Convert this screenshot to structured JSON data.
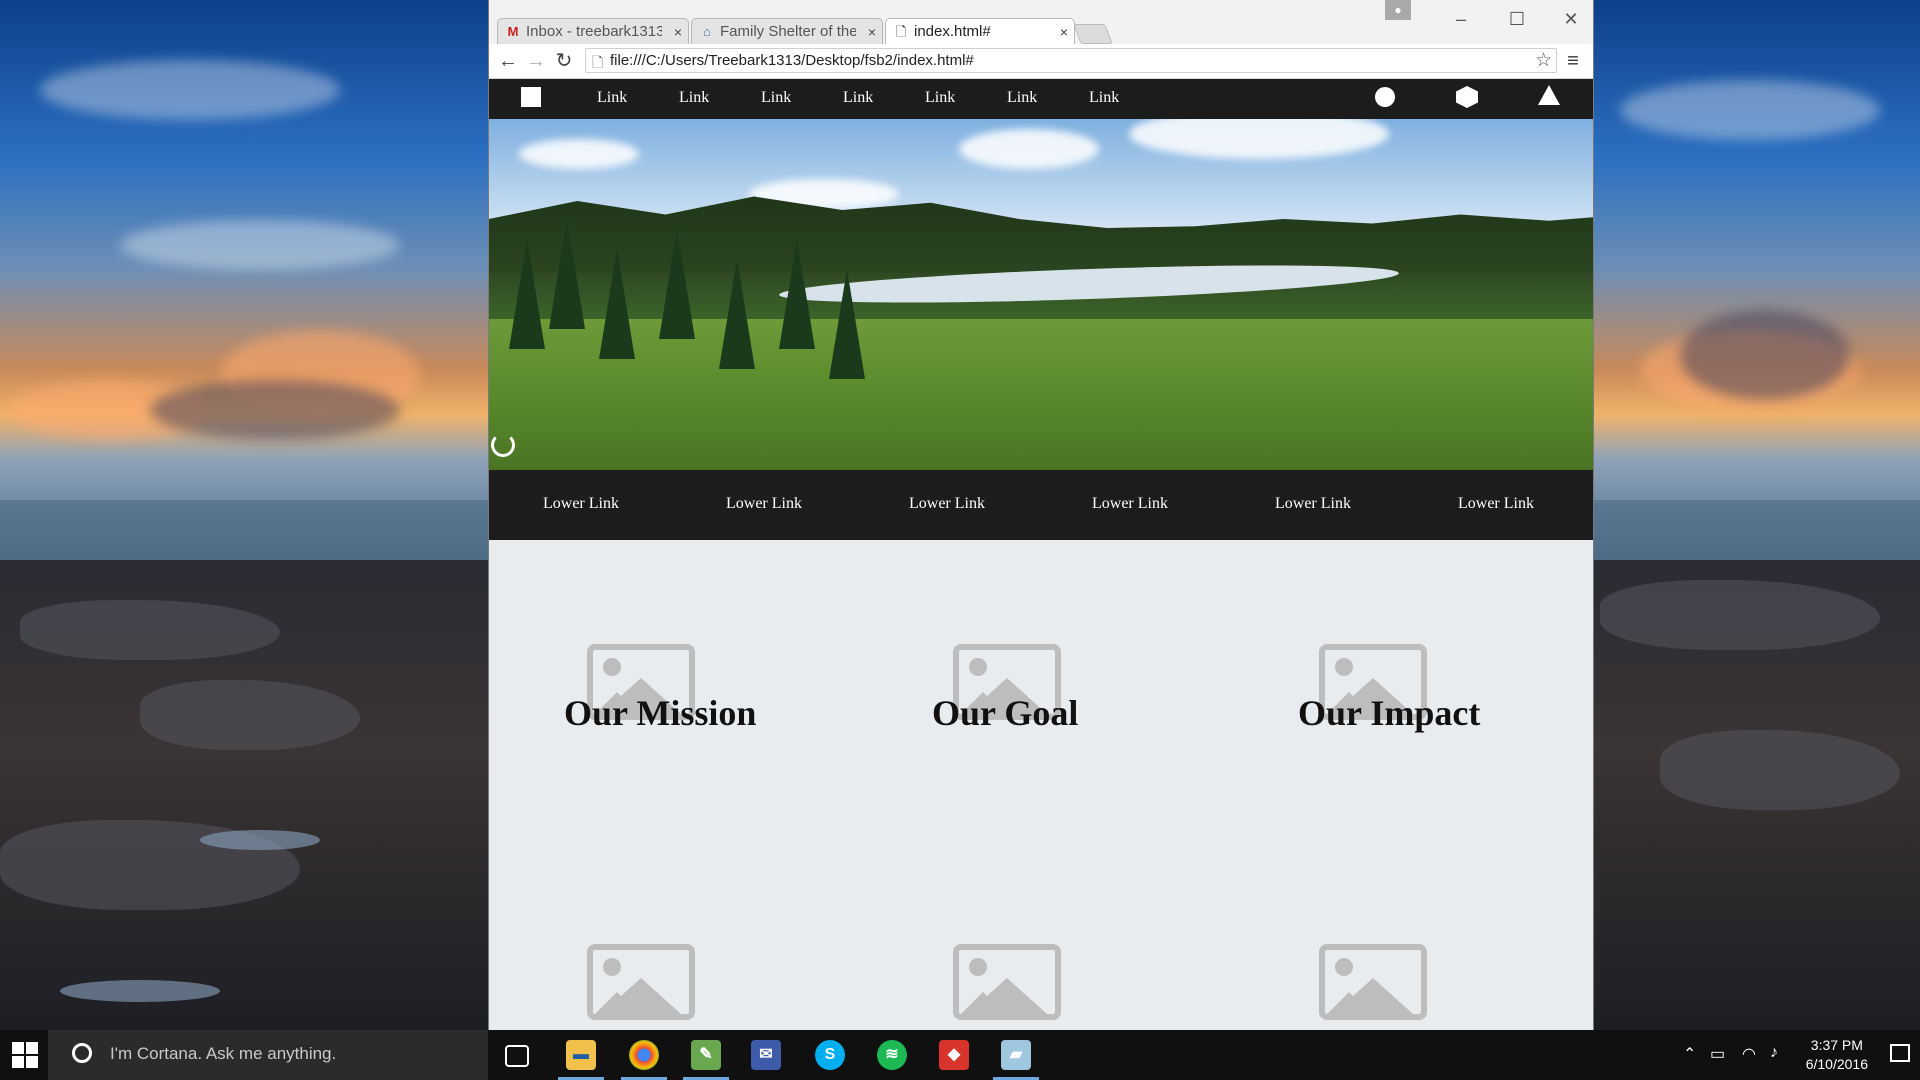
{
  "browser": {
    "tabs": [
      {
        "label": "Inbox - treebark1313",
        "favicon": "gmail-icon",
        "active": false
      },
      {
        "label": "Family Shelter of the",
        "favicon": "site-icon",
        "active": false
      },
      {
        "label": "index.html#",
        "favicon": "page-icon",
        "active": true
      }
    ],
    "url": "file:///C:/Users/Treebark1313/Desktop/fsb2/index.html#"
  },
  "page": {
    "top_nav": {
      "links": [
        "Link",
        "Link",
        "Link",
        "Link",
        "Link",
        "Link",
        "Link"
      ],
      "right_icons": [
        "circle-icon",
        "hexagon-icon",
        "triangle-icon"
      ]
    },
    "lower_nav": {
      "links": [
        "Lower Link",
        "Lower Link",
        "Lower Link",
        "Lower Link",
        "Lower Link",
        "Lower Link"
      ]
    },
    "sections": [
      {
        "title": "Our Mission"
      },
      {
        "title": "Our Goal"
      },
      {
        "title": "Our Impact"
      }
    ]
  },
  "taskbar": {
    "search_placeholder": "I'm Cortana. Ask me anything.",
    "apps": [
      "task-view-icon",
      "file-explorer-icon",
      "chrome-icon",
      "image-editor-icon",
      "document-icon",
      "skype-icon",
      "spotify-icon",
      "sketchup-icon",
      "notepad-icon"
    ],
    "time": "3:37 PM",
    "date": "6/10/2016"
  }
}
